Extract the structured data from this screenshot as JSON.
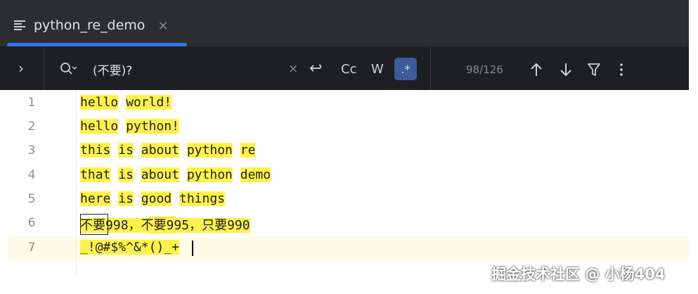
{
  "tab": {
    "title": "python_re_demo",
    "close": "×",
    "icon": "lines-icon"
  },
  "search": {
    "query": "(不要)?",
    "clear": "×",
    "toggles": {
      "wrap": "↩",
      "case": "Cc",
      "words": "W",
      "regex": ".*"
    },
    "regex_active": true,
    "count": "98/126",
    "expand_icon": "›"
  },
  "editor": {
    "lines": [
      {
        "num": "1",
        "text": "hello world!"
      },
      {
        "num": "2",
        "text": "hello python!"
      },
      {
        "num": "3",
        "text": "this is about python re"
      },
      {
        "num": "4",
        "text": "that is about python demo"
      },
      {
        "num": "5",
        "text": "here is good things"
      },
      {
        "num": "6",
        "text": "不要998，不要995，只要990"
      },
      {
        "num": "7",
        "text": "_!@#$%^&*()_+"
      }
    ],
    "current_line": 7,
    "highlight_color": "#fff34a"
  },
  "watermark": "掘金技术社区 @ 小杨404"
}
